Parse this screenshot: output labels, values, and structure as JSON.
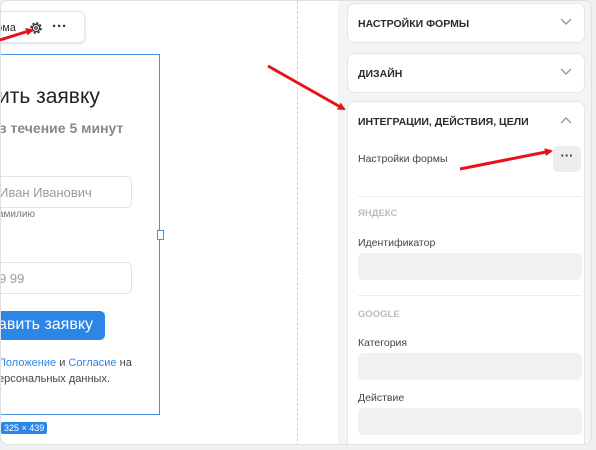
{
  "toolbar": {
    "label": "орма"
  },
  "form": {
    "title": "ить заявку",
    "subtitle": "в течение 5 минут",
    "name_placeholder": "Иван Иванович",
    "name_hint": "амилию",
    "phone_placeholder": "9 99",
    "submit_label": "авить заявку",
    "legal_link1": "Положение",
    "legal_and": "и",
    "legal_link2": "Согласие",
    "legal_tail1": "на",
    "legal_line2": "ерсональных данных."
  },
  "size_badge": "325 × 439",
  "panel": {
    "sections": [
      {
        "title": "НАСТРОЙКИ ФОРМЫ"
      },
      {
        "title": "ДИЗАЙН"
      },
      {
        "title": "ИНТЕГРАЦИИ, ДЕЙСТВИЯ, ЦЕЛИ"
      }
    ],
    "form_settings_label": "Настройки формы",
    "yandex": {
      "group": "ЯНДЕКС",
      "identifier_label": "Идентификатор",
      "identifier_value": ""
    },
    "google": {
      "group": "GOOGLE",
      "category_label": "Категория",
      "category_value": "",
      "action_label": "Действие",
      "action_value": ""
    }
  },
  "colors": {
    "accent": "#2b86e8",
    "annotation_arrow": "#e8121b"
  }
}
